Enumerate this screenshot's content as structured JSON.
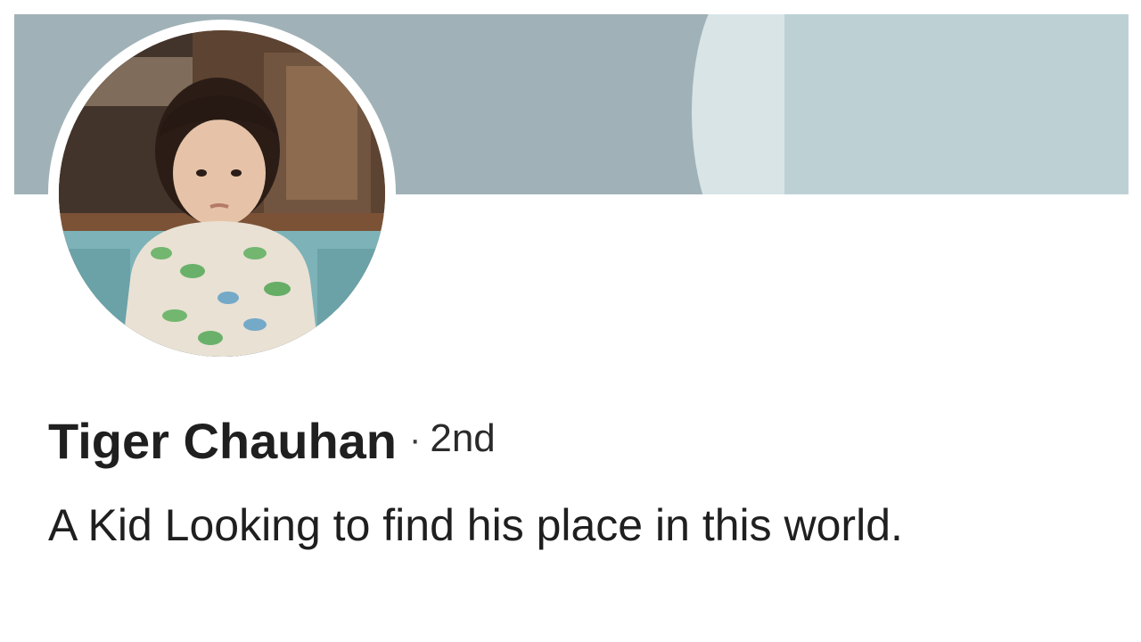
{
  "profile": {
    "name": "Tiger Chauhan",
    "separator": "·",
    "connection_degree": "2nd",
    "headline": "A Kid Looking to find his place in this world."
  },
  "colors": {
    "banner": "#a0b2b7",
    "banner_light": "#d8e4e6",
    "banner_right": "#bdd1d5",
    "text": "#1f1f1f"
  }
}
